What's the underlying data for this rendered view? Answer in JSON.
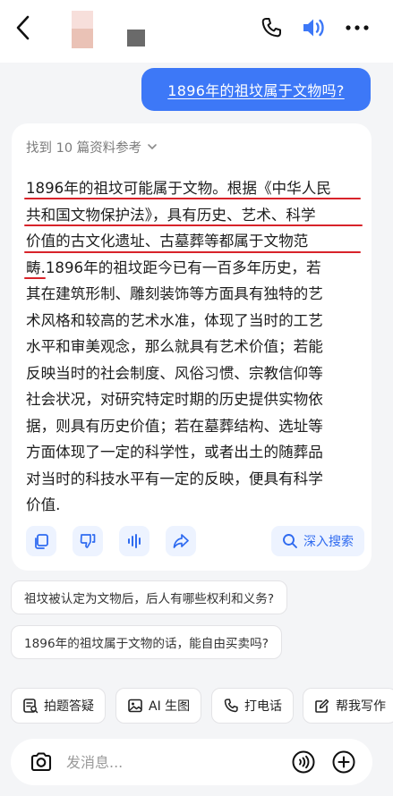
{
  "user_message": "1896年的祖坟属于文物吗?",
  "answer": {
    "sources_label": "找到 10 篇资料参考",
    "lines": [
      "1896年的祖坟可能属于文物。根据《中华人民",
      "共和国文物保护法》，具有历史、艺术、科学",
      "价值的古文化遗址、古墓葬等都属于文物范",
      "畴.1896年的祖坟距今已有一百多年历史，若",
      "其在建筑形制、雕刻装饰等方面具有独特的艺",
      "术风格和较高的艺术水准，体现了当时的工艺",
      "水平和审美观念，那么就具有艺术价值；若能",
      "反映当时的社会制度、风俗习惯、宗教信仰等",
      "社会状况，对研究特定时期的历史提供实物依",
      "据，则具有历史价值；若在墓葬结构、选址等",
      "方面体现了一定的科学性，或者出土的随葬品",
      "对当时的科技水平有一定的反映，便具有科学",
      "价值."
    ],
    "deep_search_label": "深入搜索"
  },
  "suggestions": [
    "祖坟被认定为文物后，后人有哪些权利和义务?",
    "1896年的祖坟属于文物的话，能自由买卖吗?"
  ],
  "tools": [
    {
      "label": "拍题答疑",
      "icon": "photo-question-icon"
    },
    {
      "label": "AI 生图",
      "icon": "image-icon"
    },
    {
      "label": "打电话",
      "icon": "phone-icon"
    },
    {
      "label": "帮我写作",
      "icon": "write-icon"
    }
  ],
  "composer": {
    "placeholder": "发消息..."
  },
  "colors": {
    "accent": "#3d78f7",
    "highlight_underline": "#d8232a"
  },
  "icons": {
    "back": "chevron-left-icon",
    "phone": "phone-icon",
    "speaker": "speaker-icon",
    "more": "more-icon",
    "copy": "copy-icon",
    "dislike": "thumbs-down-icon",
    "read_aloud": "audio-wave-icon",
    "share": "share-icon",
    "search": "search-icon",
    "camera": "camera-icon",
    "voice": "voice-icon",
    "plus": "plus-icon"
  }
}
